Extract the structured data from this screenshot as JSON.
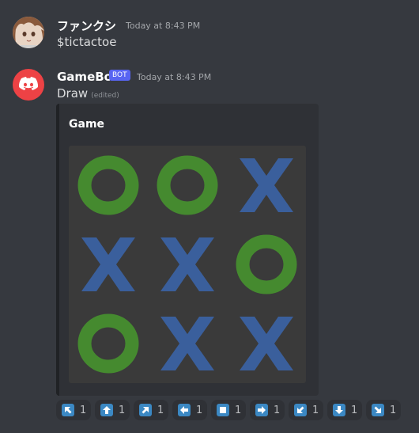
{
  "messages": [
    {
      "username": "ファンクシ",
      "timestamp": "Today at 8:43 PM",
      "content": "$tictactoe"
    },
    {
      "username": "GameBot",
      "badge": "BOT",
      "timestamp": "Today at 8:43 PM",
      "content": "Draw",
      "edited": "(edited)",
      "embed": {
        "title": "Game",
        "board": [
          [
            "O",
            "O",
            "X"
          ],
          [
            "X",
            "X",
            "O"
          ],
          [
            "O",
            "X",
            "X"
          ]
        ]
      }
    }
  ],
  "colors": {
    "o_color": "#458a2f",
    "x_color": "#3a5f9c",
    "bot_avatar": "#ed4245",
    "badge": "#5865f2"
  },
  "reactions": [
    {
      "icon": "arrow-up-left-icon",
      "count": "1"
    },
    {
      "icon": "arrow-up-icon",
      "count": "1"
    },
    {
      "icon": "arrow-up-right-icon",
      "count": "1"
    },
    {
      "icon": "arrow-left-icon",
      "count": "1"
    },
    {
      "icon": "stop-square-icon",
      "count": "1"
    },
    {
      "icon": "arrow-right-icon",
      "count": "1"
    },
    {
      "icon": "arrow-down-left-icon",
      "count": "1"
    },
    {
      "icon": "arrow-down-icon",
      "count": "1"
    },
    {
      "icon": "arrow-down-right-icon",
      "count": "1"
    }
  ]
}
